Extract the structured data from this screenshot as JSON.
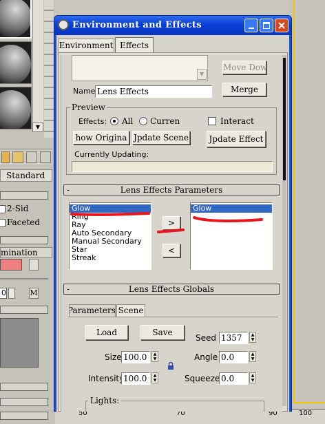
{
  "window": {
    "title": "Environment and Effects",
    "tabs": [
      "Environment",
      "Effects"
    ]
  },
  "top_section": {
    "move_down_label": "Move Down",
    "name_label": "Name:",
    "name_value": "Lens Effects",
    "merge_label": "Merge"
  },
  "preview": {
    "group_label": "Preview",
    "effects_label": "Effects:",
    "all_label": "All",
    "current_label": "Curren",
    "interactive_label": "Interact",
    "show_original_label": "how Origina",
    "update_scene_label": "Jpdate Scene",
    "update_effect_label": "Jpdate Effect",
    "currently_updating_label": "Currently Updating:"
  },
  "lens_params": {
    "title": "Lens Effects Parameters",
    "available": [
      "Glow",
      "Ring",
      "Ray",
      "Auto Secondary",
      "Manual Secondary",
      "Star",
      "Streak"
    ],
    "selected_available": "Glow",
    "active": [
      "Glow"
    ],
    "add_arrow": ">",
    "remove_arrow": "<"
  },
  "lens_globals": {
    "title": "Lens Effects Globals",
    "tabs": [
      "Parameters",
      "Scene"
    ],
    "load_label": "Load",
    "save_label": "Save",
    "seed_label": "Seed",
    "seed_value": "1357",
    "size_label": "Size",
    "size_value": "100.0",
    "angle_label": "Angle",
    "angle_value": "0.0",
    "intensity_label": "Intensity",
    "intensity_value": "100.0",
    "squeeze_label": "Squeeze",
    "squeeze_value": "0.0",
    "lights_label": "Lights:"
  },
  "background": {
    "standard_label": "Standard",
    "two_sided_label": "2-Sid",
    "faceted_label": "Faceted",
    "illumination_label": "mination",
    "m_label": "M",
    "ruler_labels": [
      "50",
      "70",
      "90",
      "100"
    ]
  },
  "colors": {
    "title_bar": "#0a3fd6",
    "window_frame": "#1b4fd8",
    "close_button": "#d9471f",
    "selection": "#3168c6",
    "panel": "#d7d4cb",
    "swatch_pink": "#f08080"
  }
}
